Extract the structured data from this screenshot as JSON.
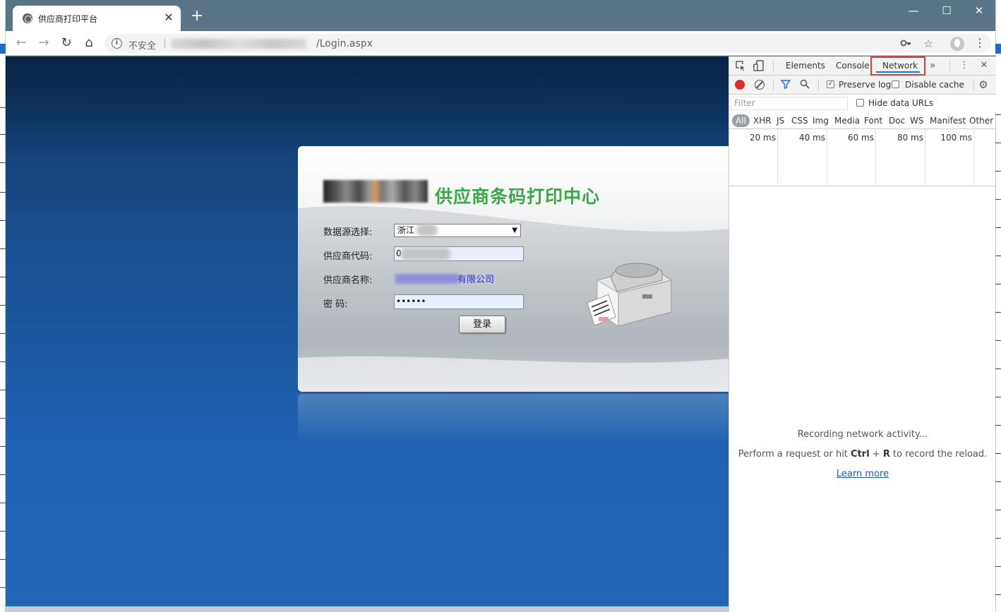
{
  "browser": {
    "tab_title": "供应商打印平台",
    "tab_close": "✕",
    "new_tab": "+",
    "window_controls": {
      "minimize": "—",
      "maximize": "☐",
      "close": "✕"
    },
    "nav": {
      "back": "←",
      "forward": "→",
      "reload": "↻",
      "home": "⌂"
    },
    "omnibox": {
      "security_label": "不安全",
      "separator": "|",
      "url_visible": "/Login.aspx",
      "key_icon": "key-icon",
      "star_icon": "star-icon"
    },
    "menu": "⋮"
  },
  "login_page": {
    "title": "供应商条码打印中心",
    "fields": {
      "datasource_label": "数据源选择:",
      "datasource_value": "浙江",
      "supplier_code_label": "供应商代码:",
      "supplier_code_value": "0",
      "supplier_name_label": "供应商名称:",
      "supplier_name_value": "有限公司",
      "password_label": "密  码:",
      "password_value": "••••••"
    },
    "login_button": "登录"
  },
  "devtools": {
    "tabs": [
      "Elements",
      "Console",
      "Network"
    ],
    "active_tab": "Network",
    "more_tabs": "»",
    "menu": "⋮",
    "close": "✕",
    "controls": {
      "preserve_log_label": "Preserve log",
      "preserve_log_checked": true,
      "disable_cache_label": "Disable cache",
      "disable_cache_checked": false
    },
    "filter_placeholder": "Filter",
    "hide_data_urls_label": "Hide data URLs",
    "types": [
      "All",
      "XHR",
      "JS",
      "CSS",
      "Img",
      "Media",
      "Font",
      "Doc",
      "WS",
      "Manifest",
      "Other"
    ],
    "timeline_labels": [
      "20 ms",
      "40 ms",
      "60 ms",
      "80 ms",
      "100 ms"
    ],
    "empty_state": {
      "line1": "Recording network activity...",
      "line2_prefix": "Perform a request or hit ",
      "line2_key1": "Ctrl",
      "line2_plus": " + ",
      "line2_key2": "R",
      "line2_suffix": " to record the reload.",
      "learn_more": "Learn more"
    },
    "colors": {
      "record": "#d93025",
      "active_underline": "#1a73e8",
      "highlight_box": "#e23b3b"
    }
  }
}
